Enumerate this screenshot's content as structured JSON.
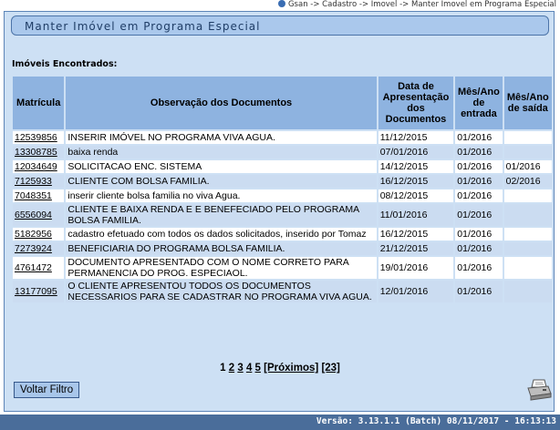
{
  "breadcrumb": "Gsan -> Cadastro -> Imovel -> Manter Imovel em Programa Especial",
  "page_title": "Manter Imóvel em Programa Especial",
  "found_label": "Imóveis Encontrados:",
  "table": {
    "headers": [
      "Matrícula",
      "Observação dos Documentos",
      "Data de Apresentação dos Documentos",
      "Mês/Ano de entrada",
      "Mês/Ano de saída"
    ],
    "rows": [
      {
        "matricula": "12539856",
        "obs": "INSERIR IMÓVEL NO PROGRAMA VIVA AGUA.",
        "data": "11/12/2015",
        "entrada": "01/2016",
        "saida": ""
      },
      {
        "matricula": "13308785",
        "obs": "baixa renda",
        "data": "07/01/2016",
        "entrada": "01/2016",
        "saida": ""
      },
      {
        "matricula": "12034649",
        "obs": "SOLICITACAO ENC. SISTEMA",
        "data": "14/12/2015",
        "entrada": "01/2016",
        "saida": "01/2016"
      },
      {
        "matricula": "7125933",
        "obs": "CLIENTE COM BOLSA FAMILIA.",
        "data": "16/12/2015",
        "entrada": "01/2016",
        "saida": "02/2016"
      },
      {
        "matricula": "7048351",
        "obs": "inserir cliente bolsa familia no viva Agua.",
        "data": "08/12/2015",
        "entrada": "01/2016",
        "saida": ""
      },
      {
        "matricula": "6556094",
        "obs": "CLIENTE E BAIXA RENDA E E BENEFECIADO PELO PROGRAMA BOLSA FAMILIA.",
        "data": "11/01/2016",
        "entrada": "01/2016",
        "saida": ""
      },
      {
        "matricula": "5182956",
        "obs": "cadastro efetuado com todos os dados solicitados, inserido por Tomaz",
        "data": "16/12/2015",
        "entrada": "01/2016",
        "saida": ""
      },
      {
        "matricula": "7273924",
        "obs": "BENEFICIARIA DO PROGRAMA BOLSA FAMILIA.",
        "data": "21/12/2015",
        "entrada": "01/2016",
        "saida": ""
      },
      {
        "matricula": "4761472",
        "obs": "DOCUMENTO APRESENTADO COM O NOME CORRETO PARA PERMANENCIA DO PROG. ESPECIAOL.",
        "data": "19/01/2016",
        "entrada": "01/2016",
        "saida": ""
      },
      {
        "matricula": "13177095",
        "obs": "O CLIENTE APRESENTOU TODOS OS DOCUMENTOS NECESSARIOS PARA SE CADASTRAR NO PROGRAMA VIVA AGUA.",
        "data": "12/01/2016",
        "entrada": "01/2016",
        "saida": ""
      }
    ]
  },
  "pagination": {
    "current": "1",
    "pages": [
      "2",
      "3",
      "4",
      "5"
    ],
    "next_label": "[Próximos]",
    "last_label": "[23]"
  },
  "back_button": "Voltar Filtro",
  "footer": "Versão: 3.13.1.1 (Batch) 08/11/2017 - 16:13:13",
  "colors": {
    "panel": "#cde0f4",
    "header": "#8eb3e0",
    "alt_row": "#cbdcf1",
    "footer": "#4a6d9a"
  },
  "icons": [
    "breadcrumb-bullet-icon",
    "printer-icon"
  ]
}
